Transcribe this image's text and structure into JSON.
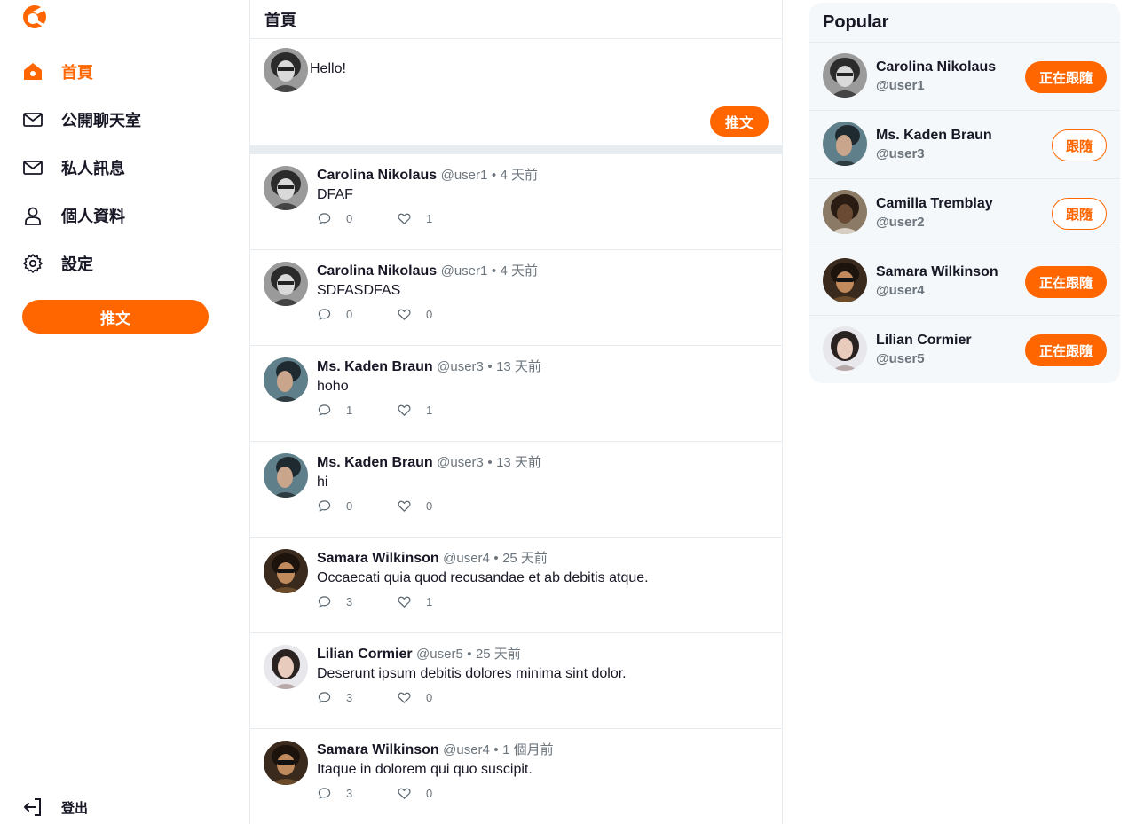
{
  "colors": {
    "accent": "#ff6600",
    "muted": "#6c757d",
    "border": "#e6ecf0",
    "panel": "#f5f8fa"
  },
  "nav": {
    "logo_icon": "ac-logo-icon",
    "items": [
      {
        "label": "首頁",
        "icon": "home-icon",
        "active": true
      },
      {
        "label": "公開聊天室",
        "icon": "mail-icon",
        "active": false
      },
      {
        "label": "私人訊息",
        "icon": "mail-icon",
        "active": false
      },
      {
        "label": "個人資料",
        "icon": "user-icon",
        "active": false
      },
      {
        "label": "設定",
        "icon": "gear-icon",
        "active": false
      }
    ],
    "tweet_button": "推文",
    "logout": {
      "label": "登出",
      "icon": "logout-icon"
    }
  },
  "header": {
    "title": "首頁"
  },
  "composer": {
    "text": "Hello!",
    "submit_label": "推文"
  },
  "tweets": [
    {
      "name": "Carolina Nikolaus",
      "handle": "@user1",
      "dot": "•",
      "time": "4 天前",
      "text": "DFAF",
      "replies": "0",
      "likes": "1"
    },
    {
      "name": "Carolina Nikolaus",
      "handle": "@user1",
      "dot": "•",
      "time": "4 天前",
      "text": "SDFASDFAS",
      "replies": "0",
      "likes": "0"
    },
    {
      "name": "Ms. Kaden Braun",
      "handle": "@user3",
      "dot": "•",
      "time": "13 天前",
      "text": "hoho",
      "replies": "1",
      "likes": "1"
    },
    {
      "name": "Ms. Kaden Braun",
      "handle": "@user3",
      "dot": "•",
      "time": "13 天前",
      "text": "hi",
      "replies": "0",
      "likes": "0"
    },
    {
      "name": "Samara Wilkinson",
      "handle": "@user4",
      "dot": "•",
      "time": "25 天前",
      "text": "Occaecati quia quod recusandae et ab debitis atque.",
      "replies": "3",
      "likes": "1"
    },
    {
      "name": "Lilian Cormier",
      "handle": "@user5",
      "dot": "•",
      "time": "25 天前",
      "text": "Deserunt ipsum debitis dolores minima sint dolor.",
      "replies": "3",
      "likes": "0"
    },
    {
      "name": "Samara Wilkinson",
      "handle": "@user4",
      "dot": "•",
      "time": "1 個月前",
      "text": "Itaque in dolorem qui quo suscipit.",
      "replies": "3",
      "likes": "0"
    }
  ],
  "popular": {
    "title": "Popular",
    "users": [
      {
        "name": "Carolina Nikolaus",
        "handle": "@user1",
        "button": "正在跟隨",
        "following": true
      },
      {
        "name": "Ms. Kaden Braun",
        "handle": "@user3",
        "button": "跟隨",
        "following": false
      },
      {
        "name": "Camilla Tremblay",
        "handle": "@user2",
        "button": "跟隨",
        "following": false
      },
      {
        "name": "Samara Wilkinson",
        "handle": "@user4",
        "button": "正在跟隨",
        "following": true
      },
      {
        "name": "Lilian Cormier",
        "handle": "@user5",
        "button": "正在跟隨",
        "following": true
      }
    ]
  }
}
